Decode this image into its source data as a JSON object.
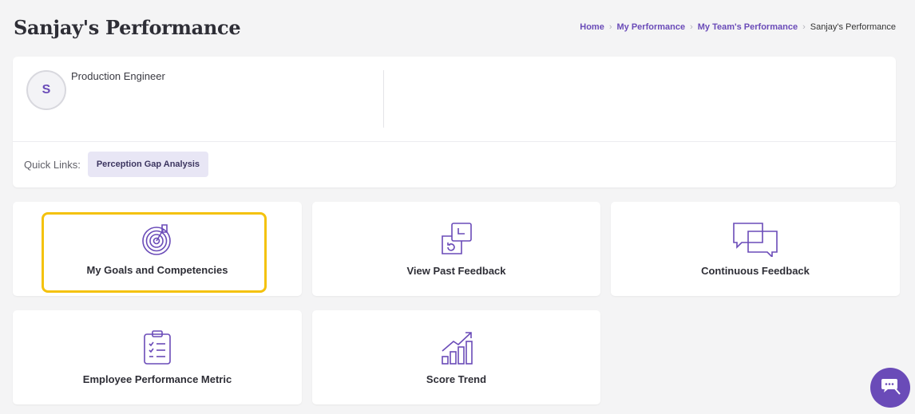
{
  "page": {
    "title": "Sanjay's Performance"
  },
  "breadcrumb": {
    "items": [
      "Home",
      "My Performance",
      "My Team's Performance"
    ],
    "current": "Sanjay's Performance"
  },
  "profile": {
    "avatar_initial": "S",
    "role": "Production Engineer"
  },
  "quick_links": {
    "label": "Quick Links:",
    "items": [
      "Perception Gap Analysis"
    ]
  },
  "tiles": [
    {
      "label": "My Goals and Competencies",
      "icon": "target-icon",
      "highlighted": true
    },
    {
      "label": "View Past Feedback",
      "icon": "feedback-history-icon"
    },
    {
      "label": "Continuous Feedback",
      "icon": "chat-bubbles-icon"
    },
    {
      "label": "Employee Performance Metric",
      "icon": "checklist-clipboard-icon"
    },
    {
      "label": "Score Trend",
      "icon": "trend-chart-icon"
    }
  ],
  "colors": {
    "accent": "#6a4bb8",
    "highlight": "#f4c20d",
    "background": "#f4f4f5"
  },
  "chat_widget": {
    "icon": "chat-support-icon"
  }
}
